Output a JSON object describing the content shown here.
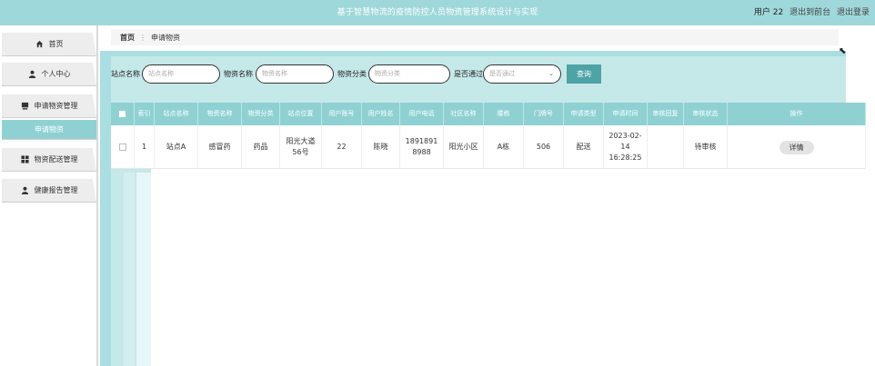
{
  "header": {
    "title": "基于智慧物流的疫情防控人员物资管理系统设计与实现",
    "user": "用户 22",
    "back_link": "退出到前台",
    "logout_link": "退出登录"
  },
  "sidebar": {
    "items": [
      {
        "label": "首页",
        "icon": "home-icon"
      },
      {
        "label": "个人中心",
        "icon": "person-icon"
      },
      {
        "label": "申请物资管理",
        "icon": "box-icon"
      },
      {
        "label": "申请物资",
        "icon": ""
      },
      {
        "label": "物资配送管理",
        "icon": "grid-icon"
      },
      {
        "label": "健康报告管理",
        "icon": "person-icon"
      }
    ]
  },
  "breadcrumb": {
    "home": "首页",
    "sep": "⋮",
    "current": "申请物资"
  },
  "search": {
    "site_label": "站点名称",
    "site_placeholder": "站点名称",
    "name_label": "物资名称",
    "name_placeholder": "物资名称",
    "category_label": "物资分类",
    "category_placeholder": "物资分类",
    "passed_label": "是否通过",
    "passed_placeholder": "是否通过",
    "query_button": "查询"
  },
  "table": {
    "headers": [
      "",
      "索引",
      "站点名称",
      "物资名称",
      "物资分类",
      "站点位置",
      "用户账号",
      "用户姓名",
      "用户电话",
      "社区名称",
      "楼栋",
      "门牌号",
      "申请类型",
      "申请时间",
      "审核回复",
      "审核状态",
      "操作"
    ],
    "rows": [
      {
        "index": "1",
        "site": "站点A",
        "item": "感冒药",
        "category": "药品",
        "location": "阳光大道56号",
        "account": "22",
        "name": "陈晓",
        "phone": "18918918988",
        "community": "阳光小区",
        "building": "A栋",
        "door": "506",
        "type": "配送",
        "time": "2023-02-14 16:28:25",
        "reply": "",
        "status": "待审核",
        "action": "详情"
      }
    ]
  },
  "colors": {
    "accent": "#8fd1d3",
    "button": "#4ea3a6",
    "panel": "#a9dfe0"
  }
}
